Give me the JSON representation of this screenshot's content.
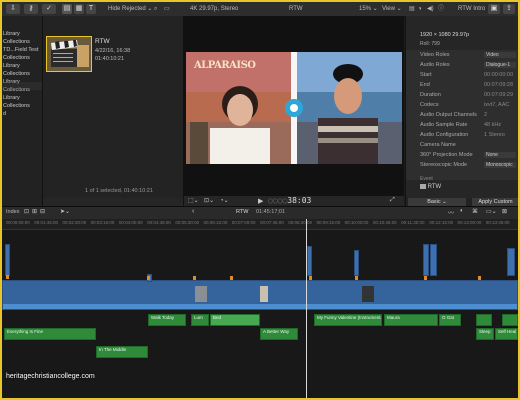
{
  "topbar": {
    "filter_label": "Hide Rejected",
    "format_info": "4K 29.97p, Stereo",
    "viewer_title": "RTW",
    "zoom": "15%",
    "view_label": "View",
    "inspector_title": "RTW Intro"
  },
  "sidebar": {
    "items": [
      "Library",
      "Collections",
      "TD...Field Test",
      "Collections",
      "Library",
      "Collections",
      "Library",
      "Collections",
      "Library",
      "Collections",
      "d"
    ]
  },
  "browser": {
    "clip_name": "RTW",
    "clip_date": "4/22/16, 16:38",
    "clip_duration": "01:40:10:21",
    "status": "1 of 1 selected, 01:40:10:21"
  },
  "viewer": {
    "timecode": "38:03",
    "sign_text": "ALPARAISO"
  },
  "inspector": {
    "resolution": "1920 × 1080 29.97p",
    "roles_prefix": "Roll",
    "roles_value": "799",
    "rows": [
      {
        "key": "Video Roles",
        "value": "Video",
        "dropdown": true
      },
      {
        "key": "Audio Roles",
        "value": "Dialogue-1",
        "dropdown": true
      },
      {
        "key": "Start",
        "value": "00:00:00:00",
        "dropdown": false
      },
      {
        "key": "End",
        "value": "00:07:09:28",
        "dropdown": false
      },
      {
        "key": "Duration",
        "value": "00:07:09:29",
        "dropdown": false
      },
      {
        "key": "Codecs",
        "value": "ixvt7, AAC",
        "dropdown": false
      },
      {
        "key": "Audio Output Channels",
        "value": "2",
        "dropdown": false
      },
      {
        "key": "Audio Sample Rate",
        "value": "48 kHz",
        "dropdown": false
      },
      {
        "key": "Audio Configuration",
        "value": "1 Stereo",
        "dropdown": false
      },
      {
        "key": "Camera Name",
        "value": "",
        "dropdown": false
      },
      {
        "key": "360° Projection Mode",
        "value": "None",
        "dropdown": true
      },
      {
        "key": "Stereoscopic Mode",
        "value": "Monoscopic",
        "dropdown": true
      }
    ],
    "event_label": "Event",
    "event_value": "RTW",
    "basic_label": "Basic",
    "apply_label": "Apply Custom"
  },
  "timeline": {
    "index_label": "Index",
    "project_name": "RTW",
    "project_time": "01:45:17;01",
    "ruler_ticks": [
      "00:00:00:00",
      "00:01:45:00",
      "00:02:30:00",
      "00:03:15:00",
      "00:04:00:00",
      "00:04:45:00",
      "00:05:30:00",
      "00:06:15:00",
      "00:07:00:00",
      "00:07:45:00",
      "00:08:30:00",
      "00:09:15:00",
      "00:10:00:00",
      "00:10:45:00",
      "00:11:30:00",
      "00:12:15:00",
      "00:13:00:00",
      "00:13:45:00"
    ],
    "audio_clips": [
      "Everything Is Fine",
      "In The Middle",
      "Walk Today",
      "Lum",
      "Bed",
      "A Better Way",
      "My Funny Valentine (Instrumental)",
      "Maura",
      "O Gat",
      "Sleep",
      "Self Heal 3"
    ]
  },
  "watermark": "heritagechristiancollege.com",
  "colors": {
    "frame": "#e8c62a",
    "accent": "#3b7ee0",
    "video_clip": "#3e6fae",
    "audio_clip": "#2f8b3a",
    "marker": "#e08a2a"
  }
}
